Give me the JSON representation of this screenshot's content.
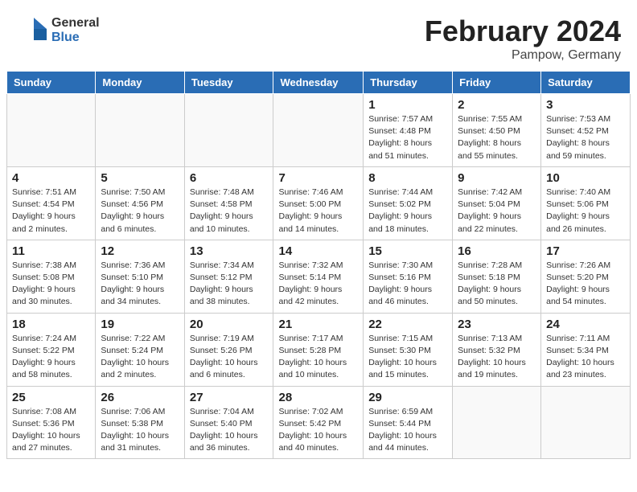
{
  "header": {
    "logo_general": "General",
    "logo_blue": "Blue",
    "title": "February 2024",
    "subtitle": "Pampow, Germany"
  },
  "weekdays": [
    "Sunday",
    "Monday",
    "Tuesday",
    "Wednesday",
    "Thursday",
    "Friday",
    "Saturday"
  ],
  "weeks": [
    [
      {
        "day": "",
        "info": ""
      },
      {
        "day": "",
        "info": ""
      },
      {
        "day": "",
        "info": ""
      },
      {
        "day": "",
        "info": ""
      },
      {
        "day": "1",
        "info": "Sunrise: 7:57 AM\nSunset: 4:48 PM\nDaylight: 8 hours\nand 51 minutes."
      },
      {
        "day": "2",
        "info": "Sunrise: 7:55 AM\nSunset: 4:50 PM\nDaylight: 8 hours\nand 55 minutes."
      },
      {
        "day": "3",
        "info": "Sunrise: 7:53 AM\nSunset: 4:52 PM\nDaylight: 8 hours\nand 59 minutes."
      }
    ],
    [
      {
        "day": "4",
        "info": "Sunrise: 7:51 AM\nSunset: 4:54 PM\nDaylight: 9 hours\nand 2 minutes."
      },
      {
        "day": "5",
        "info": "Sunrise: 7:50 AM\nSunset: 4:56 PM\nDaylight: 9 hours\nand 6 minutes."
      },
      {
        "day": "6",
        "info": "Sunrise: 7:48 AM\nSunset: 4:58 PM\nDaylight: 9 hours\nand 10 minutes."
      },
      {
        "day": "7",
        "info": "Sunrise: 7:46 AM\nSunset: 5:00 PM\nDaylight: 9 hours\nand 14 minutes."
      },
      {
        "day": "8",
        "info": "Sunrise: 7:44 AM\nSunset: 5:02 PM\nDaylight: 9 hours\nand 18 minutes."
      },
      {
        "day": "9",
        "info": "Sunrise: 7:42 AM\nSunset: 5:04 PM\nDaylight: 9 hours\nand 22 minutes."
      },
      {
        "day": "10",
        "info": "Sunrise: 7:40 AM\nSunset: 5:06 PM\nDaylight: 9 hours\nand 26 minutes."
      }
    ],
    [
      {
        "day": "11",
        "info": "Sunrise: 7:38 AM\nSunset: 5:08 PM\nDaylight: 9 hours\nand 30 minutes."
      },
      {
        "day": "12",
        "info": "Sunrise: 7:36 AM\nSunset: 5:10 PM\nDaylight: 9 hours\nand 34 minutes."
      },
      {
        "day": "13",
        "info": "Sunrise: 7:34 AM\nSunset: 5:12 PM\nDaylight: 9 hours\nand 38 minutes."
      },
      {
        "day": "14",
        "info": "Sunrise: 7:32 AM\nSunset: 5:14 PM\nDaylight: 9 hours\nand 42 minutes."
      },
      {
        "day": "15",
        "info": "Sunrise: 7:30 AM\nSunset: 5:16 PM\nDaylight: 9 hours\nand 46 minutes."
      },
      {
        "day": "16",
        "info": "Sunrise: 7:28 AM\nSunset: 5:18 PM\nDaylight: 9 hours\nand 50 minutes."
      },
      {
        "day": "17",
        "info": "Sunrise: 7:26 AM\nSunset: 5:20 PM\nDaylight: 9 hours\nand 54 minutes."
      }
    ],
    [
      {
        "day": "18",
        "info": "Sunrise: 7:24 AM\nSunset: 5:22 PM\nDaylight: 9 hours\nand 58 minutes."
      },
      {
        "day": "19",
        "info": "Sunrise: 7:22 AM\nSunset: 5:24 PM\nDaylight: 10 hours\nand 2 minutes."
      },
      {
        "day": "20",
        "info": "Sunrise: 7:19 AM\nSunset: 5:26 PM\nDaylight: 10 hours\nand 6 minutes."
      },
      {
        "day": "21",
        "info": "Sunrise: 7:17 AM\nSunset: 5:28 PM\nDaylight: 10 hours\nand 10 minutes."
      },
      {
        "day": "22",
        "info": "Sunrise: 7:15 AM\nSunset: 5:30 PM\nDaylight: 10 hours\nand 15 minutes."
      },
      {
        "day": "23",
        "info": "Sunrise: 7:13 AM\nSunset: 5:32 PM\nDaylight: 10 hours\nand 19 minutes."
      },
      {
        "day": "24",
        "info": "Sunrise: 7:11 AM\nSunset: 5:34 PM\nDaylight: 10 hours\nand 23 minutes."
      }
    ],
    [
      {
        "day": "25",
        "info": "Sunrise: 7:08 AM\nSunset: 5:36 PM\nDaylight: 10 hours\nand 27 minutes."
      },
      {
        "day": "26",
        "info": "Sunrise: 7:06 AM\nSunset: 5:38 PM\nDaylight: 10 hours\nand 31 minutes."
      },
      {
        "day": "27",
        "info": "Sunrise: 7:04 AM\nSunset: 5:40 PM\nDaylight: 10 hours\nand 36 minutes."
      },
      {
        "day": "28",
        "info": "Sunrise: 7:02 AM\nSunset: 5:42 PM\nDaylight: 10 hours\nand 40 minutes."
      },
      {
        "day": "29",
        "info": "Sunrise: 6:59 AM\nSunset: 5:44 PM\nDaylight: 10 hours\nand 44 minutes."
      },
      {
        "day": "",
        "info": ""
      },
      {
        "day": "",
        "info": ""
      }
    ]
  ]
}
